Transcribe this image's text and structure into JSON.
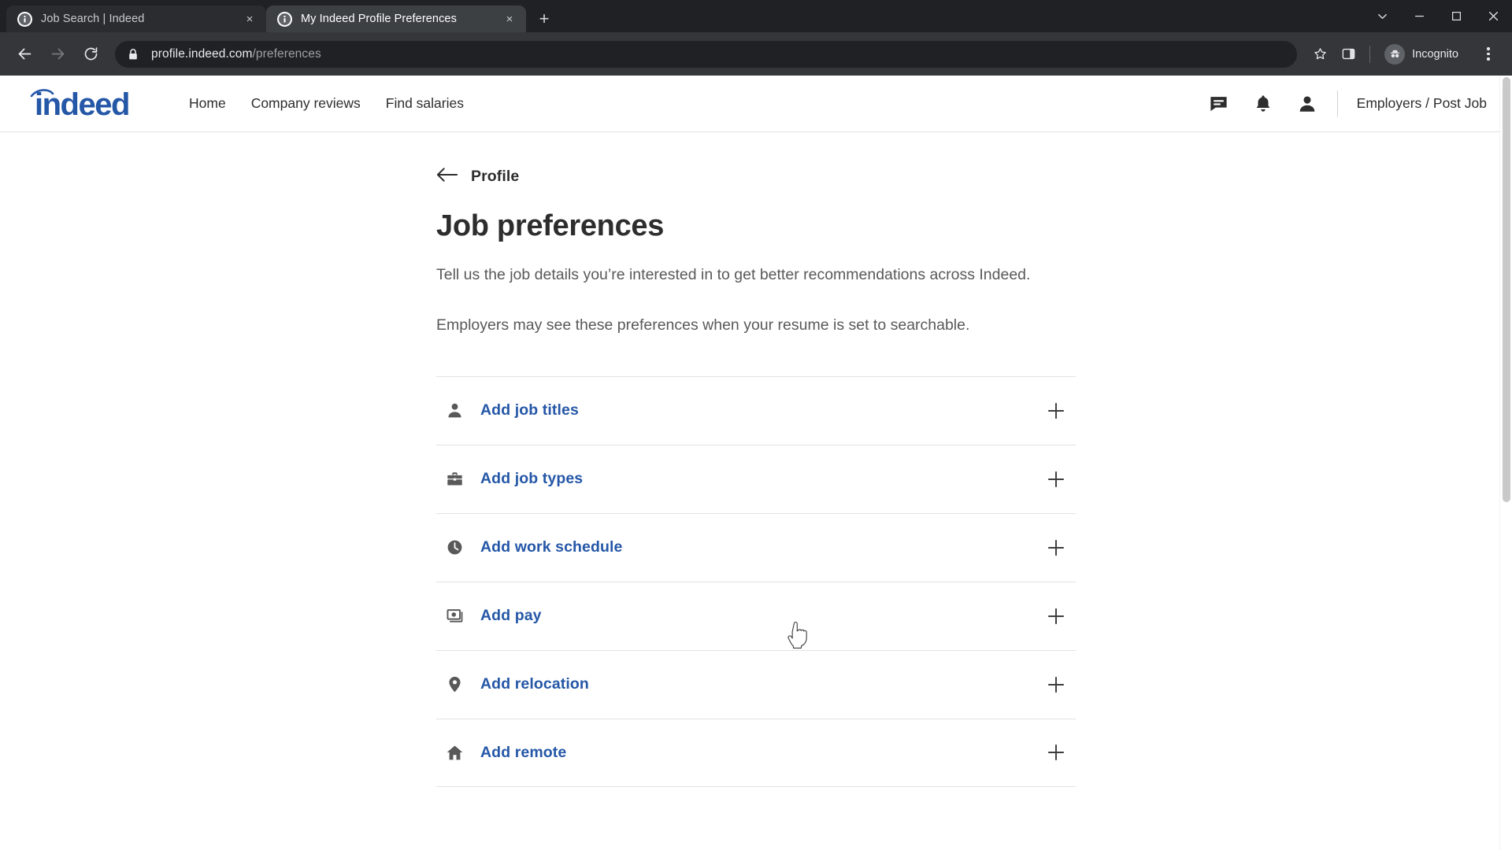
{
  "browser": {
    "tabs": [
      {
        "title": "Job Search | Indeed",
        "active": false,
        "favicon": "info-icon",
        "close_label": "×"
      },
      {
        "title": "My Indeed Profile Preferences",
        "active": true,
        "favicon": "info-icon",
        "close_label": "×"
      }
    ],
    "new_tab_label": "+",
    "window_controls": {
      "chevron": "⌄",
      "minimize": "–",
      "maximize": "❐",
      "close": "✕"
    },
    "omnibox": {
      "url_domain": "profile.indeed.com",
      "url_path": "/preferences",
      "lock_icon": "lock-icon",
      "back_icon": "back-arrow-icon",
      "forward_icon": "forward-arrow-icon",
      "reload_icon": "reload-icon",
      "star_icon": "bookmark-star-icon",
      "side_panel_icon": "side-panel-icon",
      "profile_label": "Incognito",
      "menu_icon": "kebab-menu-icon"
    }
  },
  "site": {
    "logo_text": "indeed",
    "nav": [
      {
        "label": "Home"
      },
      {
        "label": "Company reviews"
      },
      {
        "label": "Find salaries"
      }
    ],
    "icons": [
      {
        "name": "messages-icon"
      },
      {
        "name": "notifications-bell-icon"
      },
      {
        "name": "account-person-icon"
      }
    ],
    "employers_link": "Employers / Post Job"
  },
  "main": {
    "back_label": "Profile",
    "title": "Job preferences",
    "paragraph_1": "Tell us the job details you’re interested in to get better recommendations across Indeed.",
    "paragraph_2": "Employers may see these preferences when your resume is set to searchable.",
    "preferences": [
      {
        "label": "Add job titles",
        "icon": "person-icon",
        "add_label": "+"
      },
      {
        "label": "Add job types",
        "icon": "briefcase-icon",
        "add_label": "+"
      },
      {
        "label": "Add work schedule",
        "icon": "clock-icon",
        "add_label": "+"
      },
      {
        "label": "Add pay",
        "icon": "money-icon",
        "add_label": "+"
      },
      {
        "label": "Add relocation",
        "icon": "map-pin-icon",
        "add_label": "+"
      },
      {
        "label": "Add remote",
        "icon": "home-icon",
        "add_label": "+"
      }
    ]
  },
  "colors": {
    "link_blue": "#2557a7",
    "logo_navy": "#2557a7",
    "text_dark": "#2d2d2d",
    "text_muted": "#595959",
    "chrome_dark": "#202124",
    "chrome_toolbar": "#35363a",
    "tab_active": "#3c4043",
    "divider": "#e4e2e0"
  }
}
